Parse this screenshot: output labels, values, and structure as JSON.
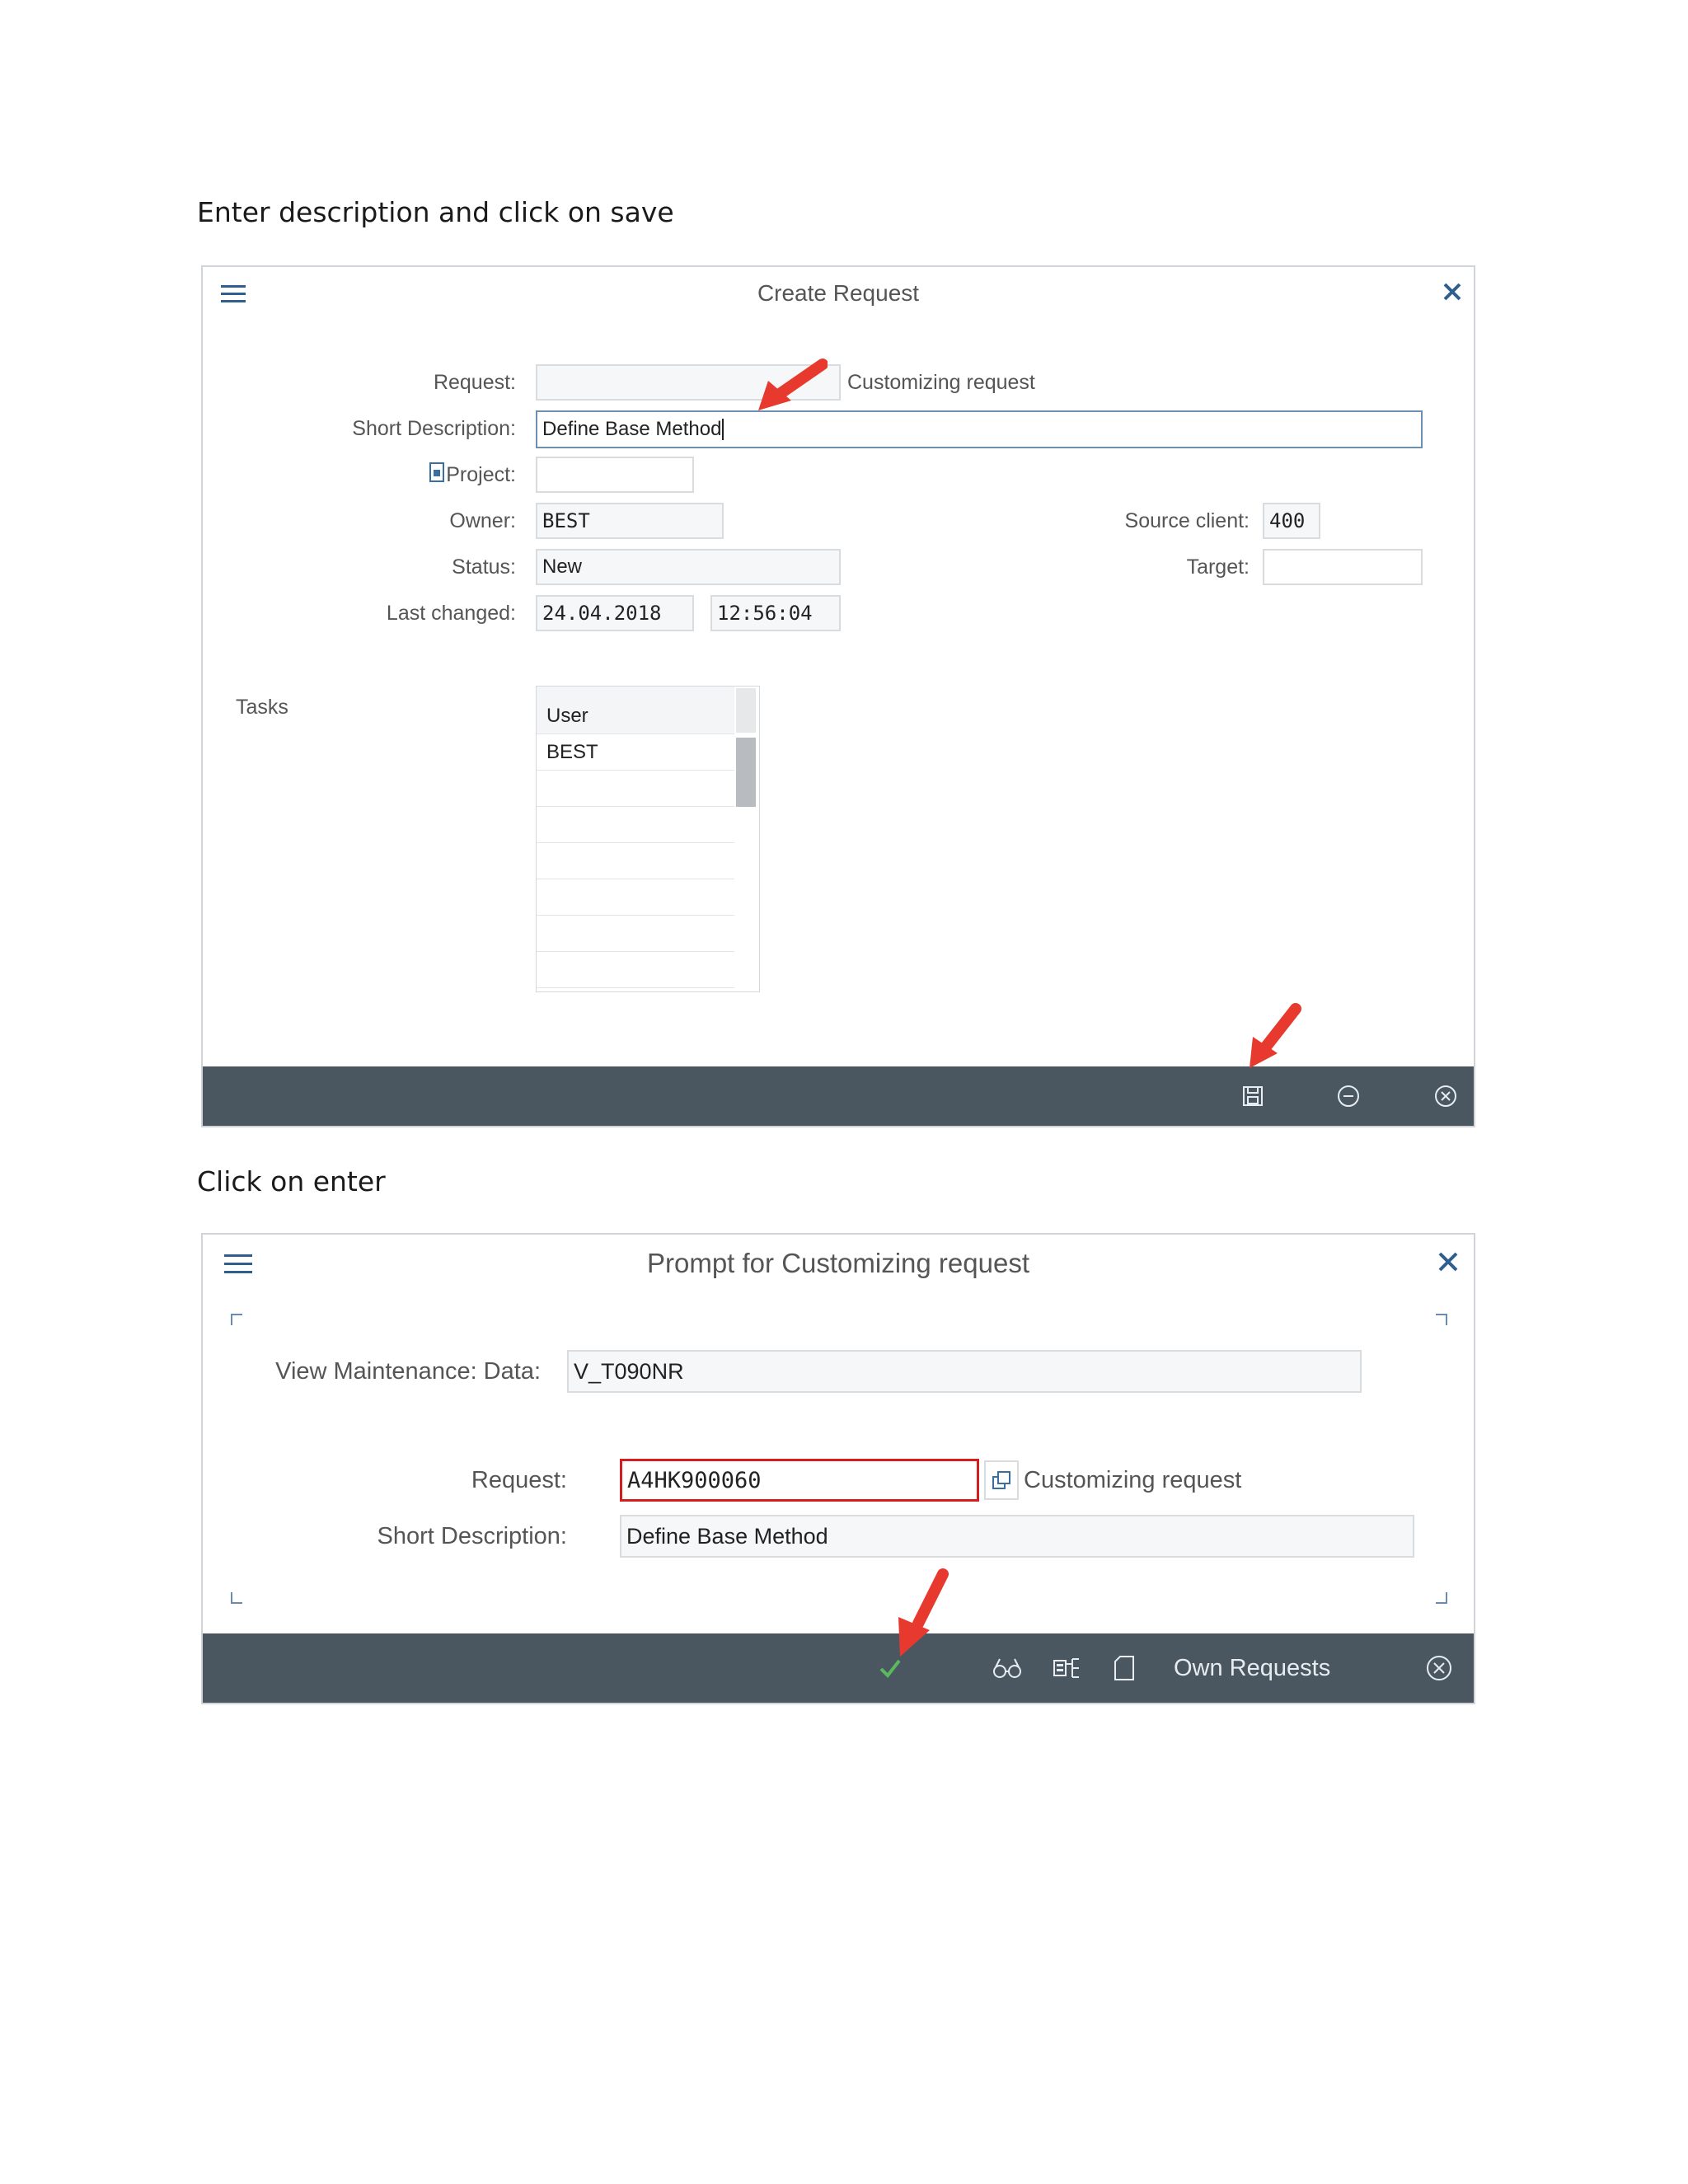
{
  "captions": {
    "first": "Enter description and click on save",
    "second": "Click on enter"
  },
  "create_request": {
    "title": "Create Request",
    "labels": {
      "request": "Request:",
      "short_description": "Short Description:",
      "project": "Project:",
      "owner": "Owner:",
      "status": "Status:",
      "last_changed": "Last changed:",
      "source_client": "Source client:",
      "target": "Target:",
      "tasks": "Tasks"
    },
    "values": {
      "request": "",
      "request_type": "Customizing request",
      "short_description": "Define Base Method",
      "project": "",
      "owner": "BEST",
      "status": "New",
      "date": "24.04.2018",
      "time": "12:56:04",
      "source_client": "400",
      "target": ""
    },
    "tasks_table": {
      "header": "User",
      "rows": [
        "BEST"
      ]
    },
    "icons": [
      "menu-icon",
      "close-icon",
      "save-icon",
      "minus-circle-icon",
      "cancel-circle-icon",
      "project-icon"
    ]
  },
  "prompt": {
    "title": "Prompt for Customizing request",
    "labels": {
      "view_maintenance": "View Maintenance: Data:",
      "request": "Request:",
      "short_description": "Short Description:"
    },
    "values": {
      "view_maintenance": "V_T090NR",
      "request": "A4HK900060",
      "request_type": "Customizing request",
      "short_description": "Define Base Method"
    },
    "footer": {
      "own_requests": "Own Requests"
    },
    "icons": [
      "menu-icon",
      "close-icon",
      "checkmark-icon",
      "glasses-icon",
      "hierarchy-icon",
      "document-icon",
      "cancel-circle-icon",
      "value-help-icon"
    ]
  },
  "colors": {
    "footer_bg": "#4a5761",
    "arrow": "#e8392e",
    "required_border": "#d21e1e",
    "check": "#5cb85c"
  }
}
